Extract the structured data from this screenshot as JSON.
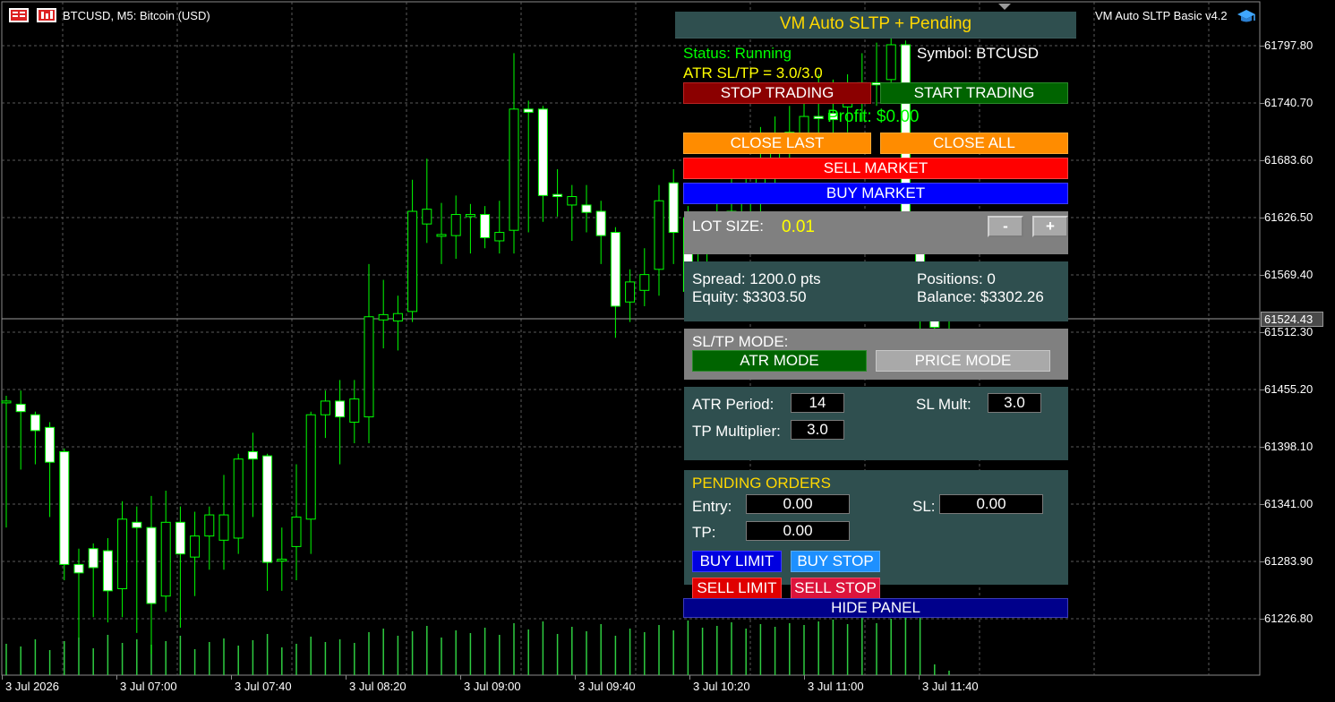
{
  "window": {
    "symbol_title": "BTCUSD, M5:  Bitcoin (USD)",
    "ea_title": "VM Auto SLTP Basic v4.2"
  },
  "price_axis": {
    "labels": [
      "61797.80",
      "61740.70",
      "61683.60",
      "61626.50",
      "61569.40",
      "61512.30",
      "61455.20",
      "61398.10",
      "61341.00",
      "61283.90",
      "61226.80"
    ],
    "current_price": "61524.43"
  },
  "time_axis": {
    "labels": [
      "3 Jul 2026",
      "3 Jul 07:00",
      "3 Jul 07:40",
      "3 Jul 08:20",
      "3 Jul 09:00",
      "3 Jul 09:40",
      "3 Jul 10:20",
      "3 Jul 11:00",
      "3 Jul 11:40"
    ]
  },
  "chart_data": {
    "type": "candlestick",
    "series_color_up": "#00ff00",
    "y_range": [
      61200,
      61815
    ],
    "candles": [
      {
        "o": 61460,
        "c": 61460,
        "h": 61465,
        "l": 61340
      },
      {
        "o": 61457,
        "c": 61450,
        "h": 61470,
        "l": 61395
      },
      {
        "o": 61447,
        "c": 61432,
        "h": 61450,
        "l": 61400
      },
      {
        "o": 61435,
        "c": 61402,
        "h": 61440,
        "l": 61350
      },
      {
        "o": 61412,
        "c": 61305,
        "h": 61415,
        "l": 61290
      },
      {
        "o": 61305,
        "c": 61297,
        "h": 61320,
        "l": 61235
      },
      {
        "o": 61320,
        "c": 61302,
        "h": 61325,
        "l": 61255
      },
      {
        "o": 61318,
        "c": 61280,
        "h": 61330,
        "l": 61250
      },
      {
        "o": 61282,
        "c": 61348,
        "h": 61365,
        "l": 61255
      },
      {
        "o": 61345,
        "c": 61340,
        "h": 61360,
        "l": 61240
      },
      {
        "o": 61340,
        "c": 61268,
        "h": 61370,
        "l": 61220
      },
      {
        "o": 61275,
        "c": 61345,
        "h": 61375,
        "l": 61260
      },
      {
        "o": 61345,
        "c": 61315,
        "h": 61360,
        "l": 61245
      },
      {
        "o": 61312,
        "c": 61332,
        "h": 61355,
        "l": 61275
      },
      {
        "o": 61332,
        "c": 61352,
        "h": 61360,
        "l": 61300
      },
      {
        "o": 61328,
        "c": 61352,
        "h": 61390,
        "l": 61300
      },
      {
        "o": 61330,
        "c": 61405,
        "h": 61410,
        "l": 61315
      },
      {
        "o": 61412,
        "c": 61405,
        "h": 61430,
        "l": 61350
      },
      {
        "o": 61408,
        "c": 61307,
        "h": 61410,
        "l": 61280
      },
      {
        "o": 61310,
        "c": 61310,
        "h": 61340,
        "l": 61280
      },
      {
        "o": 61322,
        "c": 61350,
        "h": 61400,
        "l": 61290
      },
      {
        "o": 61348,
        "c": 61447,
        "h": 61450,
        "l": 61315
      },
      {
        "o": 61447,
        "c": 61460,
        "h": 61470,
        "l": 61425
      },
      {
        "o": 61460,
        "c": 61445,
        "h": 61480,
        "l": 61400
      },
      {
        "o": 61440,
        "c": 61462,
        "h": 61480,
        "l": 61420
      },
      {
        "o": 61445,
        "c": 61540,
        "h": 61590,
        "l": 61420
      },
      {
        "o": 61537,
        "c": 61542,
        "h": 61575,
        "l": 61510
      },
      {
        "o": 61536,
        "c": 61543,
        "h": 61560,
        "l": 61508
      },
      {
        "o": 61545,
        "c": 61640,
        "h": 61670,
        "l": 61535
      },
      {
        "o": 61628,
        "c": 61642,
        "h": 61690,
        "l": 61610
      },
      {
        "o": 61617,
        "c": 61618,
        "h": 61648,
        "l": 61590
      },
      {
        "o": 61617,
        "c": 61637,
        "h": 61655,
        "l": 61595
      },
      {
        "o": 61635,
        "c": 61637,
        "h": 61647,
        "l": 61600
      },
      {
        "o": 61637,
        "c": 61615,
        "h": 61645,
        "l": 61605
      },
      {
        "o": 61612,
        "c": 61620,
        "h": 61650,
        "l": 61600
      },
      {
        "o": 61622,
        "c": 61737,
        "h": 61790,
        "l": 61600
      },
      {
        "o": 61737,
        "c": 61734,
        "h": 61745,
        "l": 61620
      },
      {
        "o": 61737,
        "c": 61655,
        "h": 61740,
        "l": 61630
      },
      {
        "o": 61656,
        "c": 61654,
        "h": 61680,
        "l": 61635
      },
      {
        "o": 61646,
        "c": 61654,
        "h": 61665,
        "l": 61612
      },
      {
        "o": 61646,
        "c": 61639,
        "h": 61665,
        "l": 61620
      },
      {
        "o": 61640,
        "c": 61617,
        "h": 61650,
        "l": 61590
      },
      {
        "o": 61620,
        "c": 61550,
        "h": 61625,
        "l": 61520
      },
      {
        "o": 61554,
        "c": 61573,
        "h": 61585,
        "l": 61535
      },
      {
        "o": 61565,
        "c": 61580,
        "h": 61605,
        "l": 61550
      },
      {
        "o": 61585,
        "c": 61650,
        "h": 61665,
        "l": 61560
      },
      {
        "o": 61667,
        "c": 61620,
        "h": 61680,
        "l": 61590
      },
      {
        "o": 61634,
        "c": 61564,
        "h": 61645,
        "l": 61560
      },
      {
        "o": 61564,
        "c": 61634,
        "h": 61640,
        "l": 61550
      },
      {
        "o": 61635,
        "c": 61615,
        "h": 61660,
        "l": 61600
      },
      {
        "o": 61612,
        "c": 61640,
        "h": 61680,
        "l": 61600
      },
      {
        "o": 61615,
        "c": 61660,
        "h": 61690,
        "l": 61600
      },
      {
        "o": 61660,
        "c": 61680,
        "h": 61720,
        "l": 61640
      },
      {
        "o": 61690,
        "c": 61700,
        "h": 61730,
        "l": 61660
      },
      {
        "o": 61702,
        "c": 61715,
        "h": 61740,
        "l": 61690
      },
      {
        "o": 61712,
        "c": 61730,
        "h": 61760,
        "l": 61700
      },
      {
        "o": 61730,
        "c": 61728,
        "h": 61770,
        "l": 61700
      },
      {
        "o": 61733,
        "c": 61727,
        "h": 61765,
        "l": 61700
      },
      {
        "o": 61739,
        "c": 61745,
        "h": 61770,
        "l": 61715
      },
      {
        "o": 61745,
        "c": 61762,
        "h": 61790,
        "l": 61725
      },
      {
        "o": 61762,
        "c": 61760,
        "h": 61800,
        "l": 61740
      },
      {
        "o": 61765,
        "c": 61798,
        "h": 61805,
        "l": 61750
      },
      {
        "o": 61798,
        "c": 61625,
        "h": 61802,
        "l": 61600
      },
      {
        "o": 61628,
        "c": 61540,
        "h": 61630,
        "l": 61515
      },
      {
        "o": 61540,
        "c": 61530,
        "h": 61560,
        "l": 61510
      },
      {
        "o": 61525,
        "c": 61526,
        "h": 61545,
        "l": 61510
      }
    ],
    "volumes": [
      35,
      32,
      40,
      28,
      38,
      42,
      30,
      45,
      36,
      40,
      34,
      38,
      44,
      29,
      37,
      41,
      33,
      39,
      46,
      31,
      35,
      43,
      37,
      40,
      36,
      48,
      52,
      44,
      49,
      55,
      42,
      50,
      47,
      53,
      45,
      58,
      51,
      60,
      46,
      54,
      49,
      57,
      44,
      52,
      48,
      56,
      50,
      61,
      53,
      55,
      59,
      52,
      57,
      54,
      58,
      56,
      60,
      62,
      57,
      65,
      58,
      63,
      70,
      66,
      12,
      5
    ]
  },
  "panel": {
    "title": "VM Auto SLTP + Pending",
    "status": "Status: Running",
    "symbol": "Symbol: BTCUSD",
    "atr_sltp": "ATR SL/TP = 3.0/3.0",
    "stop_trading": "STOP TRADING",
    "start_trading": "START TRADING",
    "profit": "Profit: $0.00",
    "close_last": "CLOSE LAST",
    "close_all": "CLOSE ALL",
    "sell_market": "SELL MARKET",
    "buy_market": "BUY MARKET",
    "lot_label": "LOT SIZE:",
    "lot_value": "0.01",
    "minus": "-",
    "plus": "+",
    "spread": "Spread: 1200.0 pts",
    "positions": "Positions: 0",
    "equity": "Equity: $3303.50",
    "balance": "Balance: $3302.26",
    "mode_label": "SL/TP MODE:",
    "atr_mode": "ATR MODE",
    "price_mode": "PRICE MODE",
    "atr_period_label": "ATR Period:",
    "atr_period": "14",
    "sl_mult_label": "SL Mult:",
    "sl_mult": "3.0",
    "tp_mult_label": "TP Multiplier:",
    "tp_mult": "3.0",
    "pending_title": "PENDING ORDERS",
    "entry_label": "Entry:",
    "entry": "0.00",
    "sl_label": "SL:",
    "sl": "0.00",
    "tp_label": "TP:",
    "tp": "0.00",
    "buy_limit": "BUY LIMIT",
    "buy_stop": "BUY STOP",
    "sell_limit": "SELL LIMIT",
    "sell_stop": "SELL STOP",
    "hide_panel": "HIDE PANEL"
  }
}
